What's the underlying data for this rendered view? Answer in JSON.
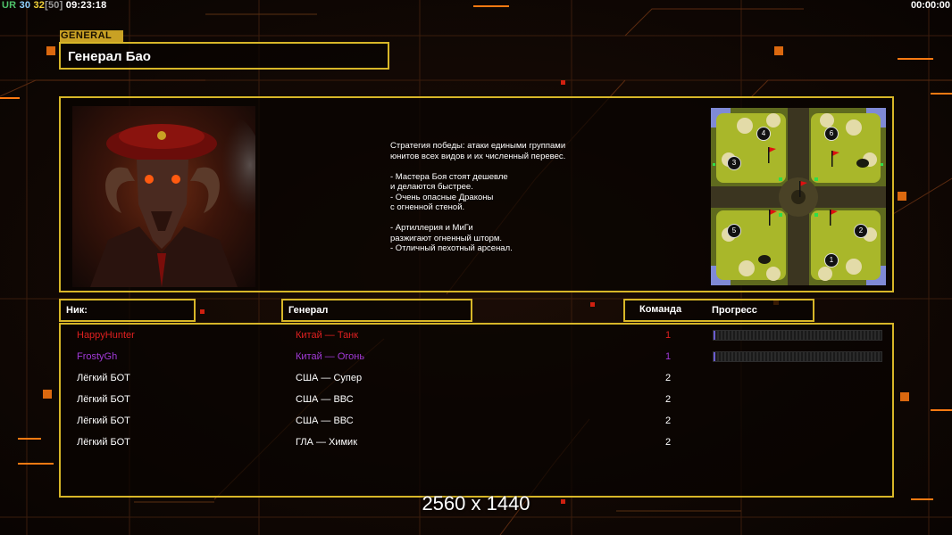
{
  "hud": {
    "ur_label": "UR",
    "ur_value": "30",
    "fps_value": "32",
    "fps_cap": "[50]",
    "clock": "09:23:18",
    "timer": "00:00:00"
  },
  "general_tag": "GENERAL",
  "general_name": "Генерал Бао",
  "description_lines": [
    "Стратегия победы: атаки едиными группами",
    "юнитов всех видов и их численный перевес.",
    "",
    "- Мастера Боя стоят дешевле",
    "и делаются быстрее.",
    "- Очень опасные Драконы",
    "с огненной стеной.",
    "",
    "- Артиллерия и МиГи",
    "разжигают огненный шторм.",
    "- Отличный пехотный арсенал."
  ],
  "minimap": {
    "slot_numbers": [
      "4",
      "6",
      "3",
      "5",
      "2",
      "1"
    ]
  },
  "headers": {
    "nick": "Ник:",
    "general": "Генерал",
    "team": "Команда",
    "progress": "Прогресс"
  },
  "players": [
    {
      "nick": "HappyHunter",
      "general": "Китай — Танк",
      "team": "1",
      "color": "#e02020",
      "progress": 0.01,
      "show_progress": true
    },
    {
      "nick": "FrostyGh",
      "general": "Китай — Огонь",
      "team": "1",
      "color": "#a23ad8",
      "progress": 0.01,
      "show_progress": true
    },
    {
      "nick": "Лёгкий БОТ",
      "general": "США — Супер",
      "team": "2",
      "color": "#ffffff",
      "show_progress": false
    },
    {
      "nick": "Лёгкий БОТ",
      "general": "США — ВВС",
      "team": "2",
      "color": "#ffffff",
      "show_progress": false
    },
    {
      "nick": "Лёгкий БОТ",
      "general": "США — ВВС",
      "team": "2",
      "color": "#ffffff",
      "show_progress": false
    },
    {
      "nick": "Лёгкий БОТ",
      "general": "ГЛА — Химик",
      "team": "2",
      "color": "#ffffff",
      "show_progress": false
    }
  ],
  "resolution_text": "2560 x 1440",
  "colors": {
    "frame": "#d7b628",
    "accent_orange": "#ff7a12",
    "background": "#0f0806"
  }
}
